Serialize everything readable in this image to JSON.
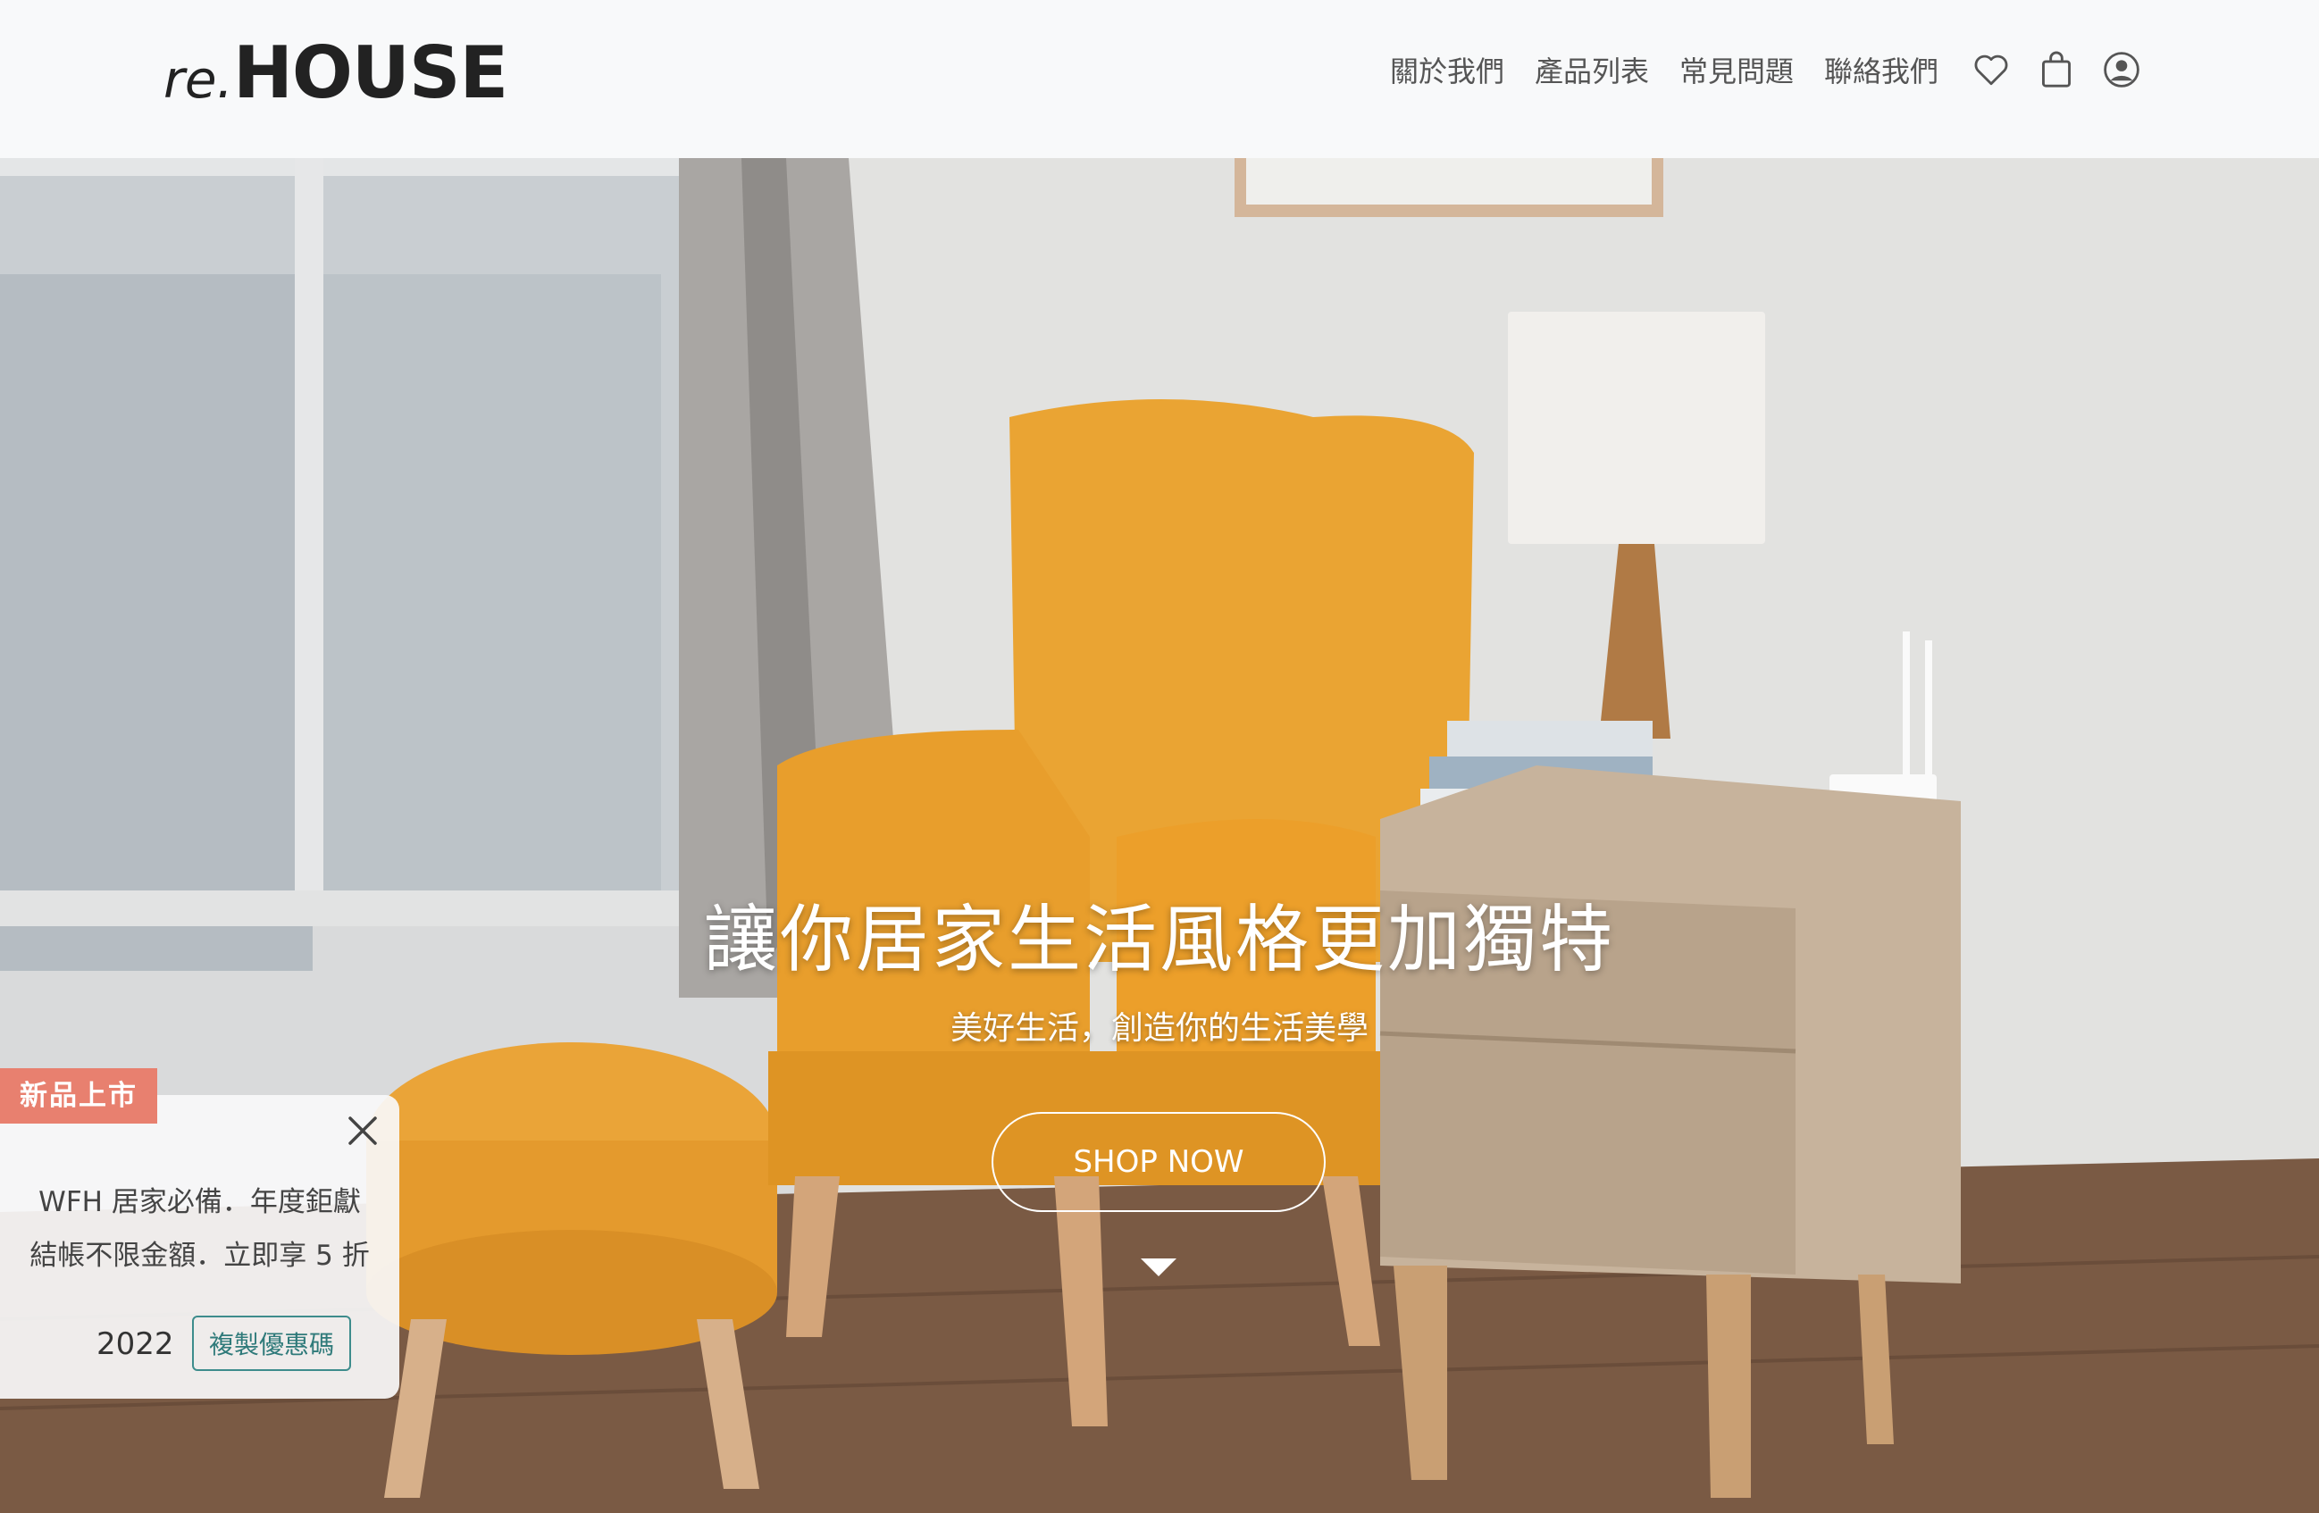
{
  "header": {
    "logo_re": "re.",
    "logo_house": "HOUSE",
    "nav": [
      "關於我們",
      "產品列表",
      "常見問題",
      "聯絡我們"
    ],
    "icons": [
      "heart-icon",
      "shopping-bag-icon",
      "user-icon"
    ]
  },
  "hero": {
    "title": "讓你居家生活風格更加獨特",
    "subtitle": "美好生活，創造你的生活美學",
    "cta": "SHOP NOW"
  },
  "promo": {
    "tag": "新品上市",
    "line1": "WFH 居家必備．年度鉅獻",
    "line2": "結帳不限金額．立即享 5 折",
    "code": "2022",
    "copy_label": "複製優惠碼"
  },
  "colors": {
    "promo_tag": "#e8806f",
    "copy_button": "#3d8c8c",
    "chair": "#e9a233"
  }
}
